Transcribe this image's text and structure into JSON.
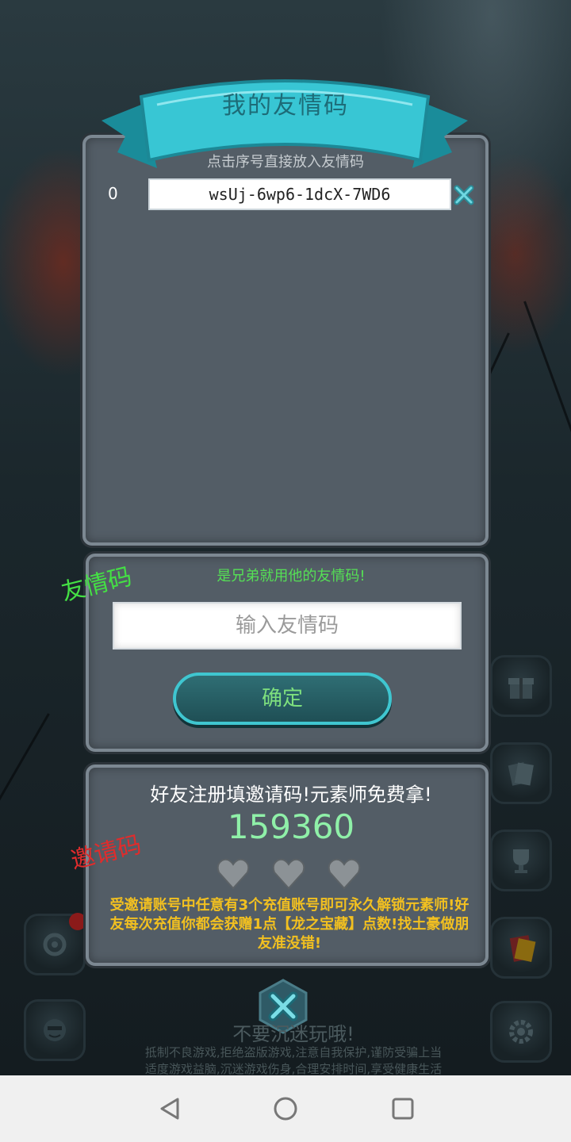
{
  "header": {
    "title": "我的友情码",
    "hint": "点击序号直接放入友情码"
  },
  "my_codes": [
    {
      "index": "0",
      "code": "wsUj-6wp6-1dcX-7WD6"
    }
  ],
  "friend_section": {
    "side_label": "友情码",
    "hint": "是兄弟就用他的友情码!",
    "input_placeholder": "输入友情码",
    "confirm_label": "确定"
  },
  "invite_section": {
    "side_label": "邀请码",
    "title": "好友注册填邀请码!元素师免费拿!",
    "code": "159360",
    "hearts_total": 3,
    "hearts_filled": 0,
    "reward_text": "受邀请账号中任意有3个充值账号即可永久解锁元素师!好友每次充值你都会获赠1点【龙之宝藏】点数!找土豪做朋友准没错!"
  },
  "footer": {
    "warning": "不要沉迷玩哦!",
    "line1": "抵制不良游戏,拒绝盗版游戏,注意自我保护,谨防受骗上当",
    "line2": "适度游戏益脑,沉迷游戏伤身,合理安排时间,享受健康生活"
  },
  "colors": {
    "accent": "#3fc6d0",
    "green": "#55e055",
    "gold": "#f2c020",
    "panel": "#535d66"
  },
  "nav": {
    "back": "back-icon",
    "home": "home-icon",
    "recents": "recents-icon"
  }
}
